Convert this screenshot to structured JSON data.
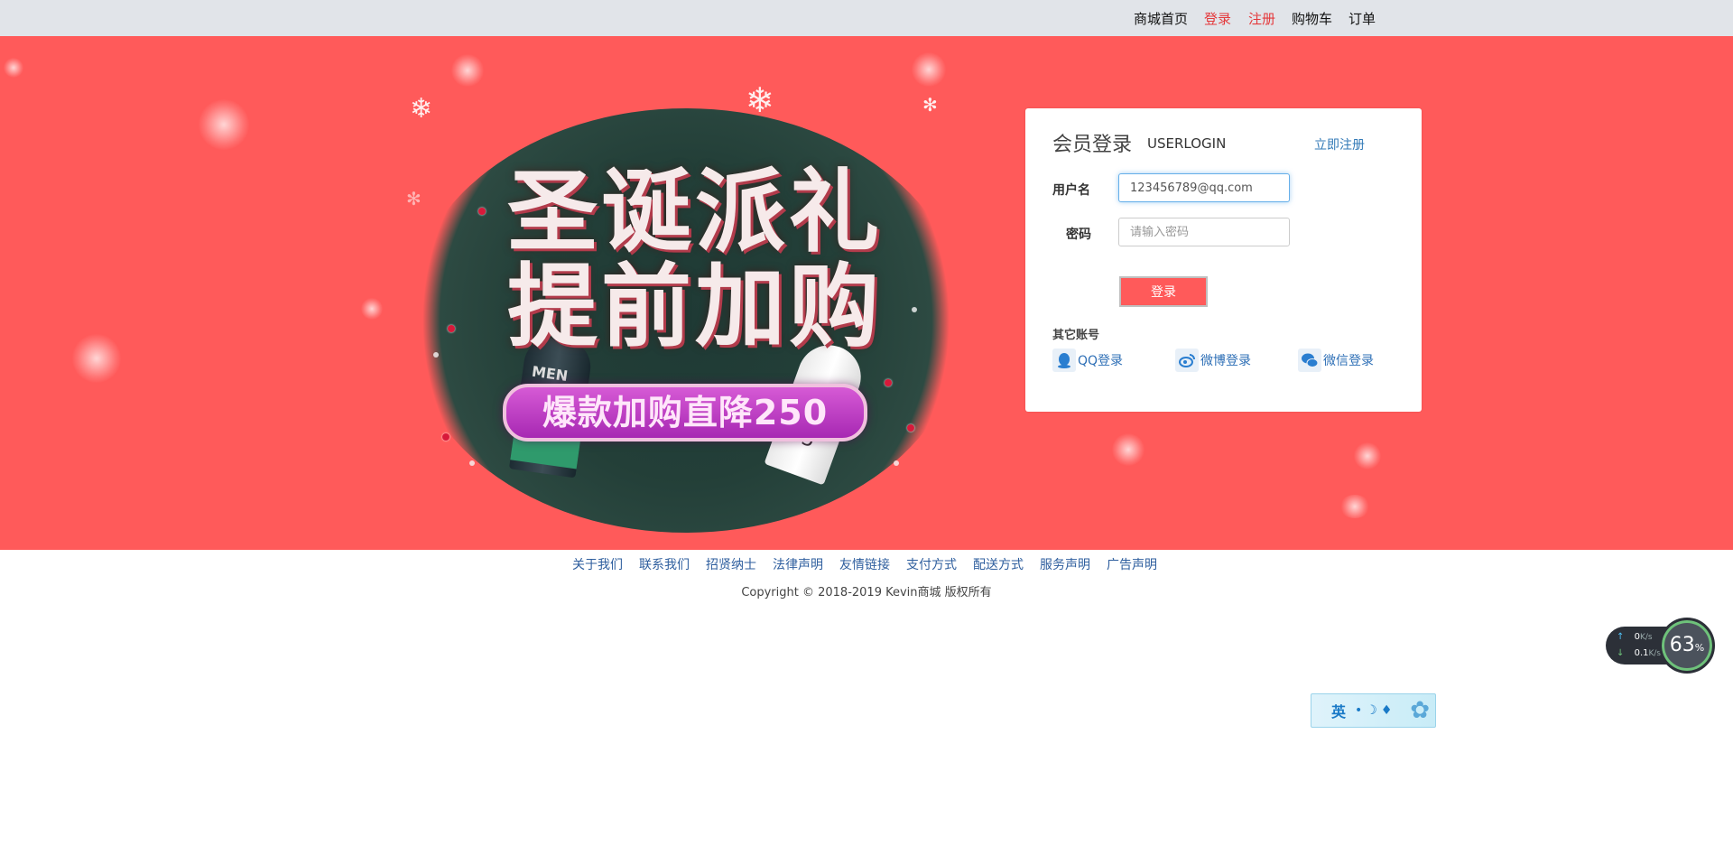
{
  "topnav": {
    "items": [
      {
        "label": "商城首页",
        "active": false
      },
      {
        "label": "登录",
        "active": true
      },
      {
        "label": "注册",
        "active": true
      },
      {
        "label": "购物车",
        "active": false
      },
      {
        "label": "订单",
        "active": false
      }
    ]
  },
  "banner": {
    "line1": "圣诞派礼",
    "line2": "提前加购",
    "tag": "爆款加购直降250",
    "product_label": "55°",
    "product_brand": "MEN"
  },
  "login": {
    "title": "会员登录",
    "subtitle": "USERLOGIN",
    "register_link": "立即注册",
    "username_label": "用户名",
    "username_value": "123456789@qq.com",
    "password_label": "密码",
    "password_placeholder": "请输入密码",
    "submit_label": "登录",
    "other_label": "其它账号",
    "social": [
      {
        "label": "QQ登录",
        "icon": "qq-icon"
      },
      {
        "label": "微博登录",
        "icon": "weibo-icon"
      },
      {
        "label": "微信登录",
        "icon": "wechat-icon"
      }
    ]
  },
  "footer": {
    "links": [
      "关于我们",
      "联系我们",
      "招贤纳士",
      "法律声明",
      "友情链接",
      "支付方式",
      "配送方式",
      "服务声明",
      "广告声明"
    ],
    "copyright": "Copyright © 2018-2019 Kevin商城 版权所有"
  },
  "speed_widget": {
    "upload": "0",
    "download": "0.1",
    "unit": "K/s",
    "percent": "63",
    "percent_suffix": "%"
  },
  "ime": {
    "lang": "英"
  },
  "colors": {
    "banner": "#ff5a5a",
    "topbar": "#e1e4e9",
    "link": "#337ab7",
    "active_nav": "#e4393c"
  }
}
